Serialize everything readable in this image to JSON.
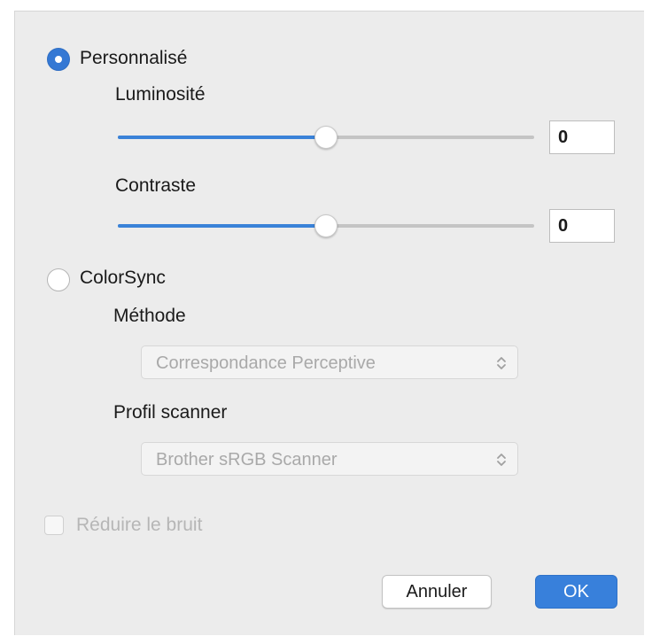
{
  "custom": {
    "label": "Personnalisé",
    "selected": true,
    "brightness": {
      "label": "Luminosité",
      "value": "0",
      "slider_fraction": 0.5
    },
    "contrast": {
      "label": "Contraste",
      "value": "0",
      "slider_fraction": 0.5
    }
  },
  "colorsync": {
    "label": "ColorSync",
    "selected": false,
    "method": {
      "label": "Méthode",
      "selected": "Correspondance Perceptive"
    },
    "profile": {
      "label": "Profil scanner",
      "selected": "Brother sRGB Scanner"
    }
  },
  "noise_reduction": {
    "label": "Réduire le bruit",
    "checked": false,
    "enabled": false
  },
  "buttons": {
    "cancel": "Annuler",
    "ok": "OK"
  },
  "colors": {
    "accent": "#3478d4",
    "background": "#ececec",
    "disabled_text": "#b6b6b6"
  }
}
